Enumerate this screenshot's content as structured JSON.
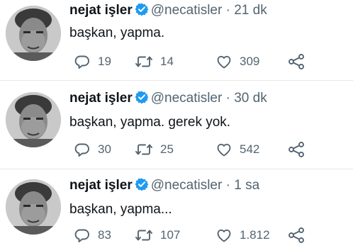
{
  "tweets": [
    {
      "display_name": "nejat işler",
      "handle": "@necatisler",
      "separator": "·",
      "time": "21 dk",
      "text": "başkan, yapma.",
      "replies": "19",
      "retweets": "14",
      "likes": "309"
    },
    {
      "display_name": "nejat işler",
      "handle": "@necatisler",
      "separator": "·",
      "time": "30 dk",
      "text": "başkan, yapma. gerek yok.",
      "replies": "30",
      "retweets": "25",
      "likes": "542"
    },
    {
      "display_name": "nejat işler",
      "handle": "@necatisler",
      "separator": "·",
      "time": "1 sa",
      "text": "başkan, yapma...",
      "replies": "83",
      "retweets": "107",
      "likes": "1.812"
    }
  ],
  "colors": {
    "verified": "#1d9bf0",
    "text_primary": "#0f1419",
    "text_secondary": "#536471",
    "divider": "#e6e6e6"
  },
  "icons": [
    "verified-badge-icon",
    "reply-icon",
    "retweet-icon",
    "like-icon",
    "share-icon"
  ]
}
